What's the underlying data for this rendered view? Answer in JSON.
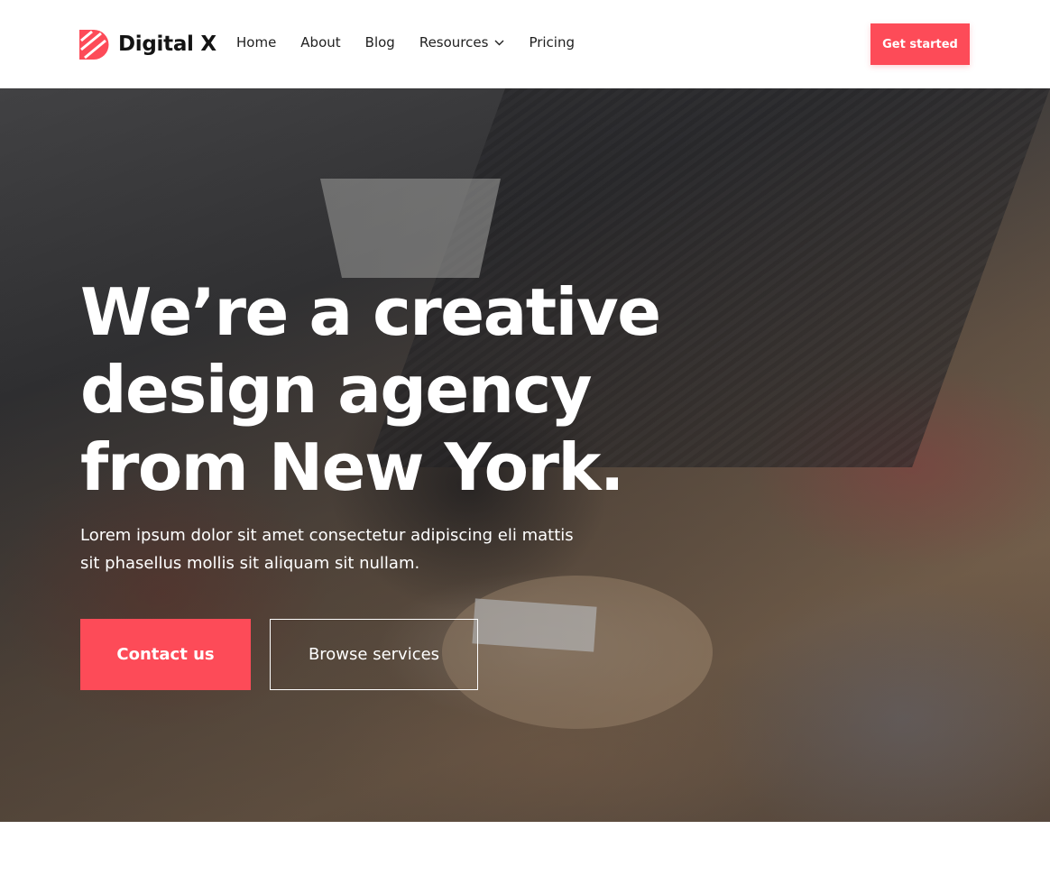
{
  "brand": {
    "name": "Digital X",
    "accent_color": "#fd4b58"
  },
  "nav": {
    "items": [
      {
        "label": "Home"
      },
      {
        "label": "About"
      },
      {
        "label": "Blog"
      },
      {
        "label": "Resources",
        "icon": "chevron-down-icon"
      },
      {
        "label": "Pricing"
      }
    ],
    "cta_label": "Get started"
  },
  "hero": {
    "title": "We’re a creative design agency from New York.",
    "subtitle": "Lorem ipsum dolor sit amet consectetur adipiscing eli mattis sit phasellus mollis sit aliquam sit nullam.",
    "primary_button": "Contact us",
    "secondary_button": "Browse services",
    "background": "office meeting photo"
  }
}
